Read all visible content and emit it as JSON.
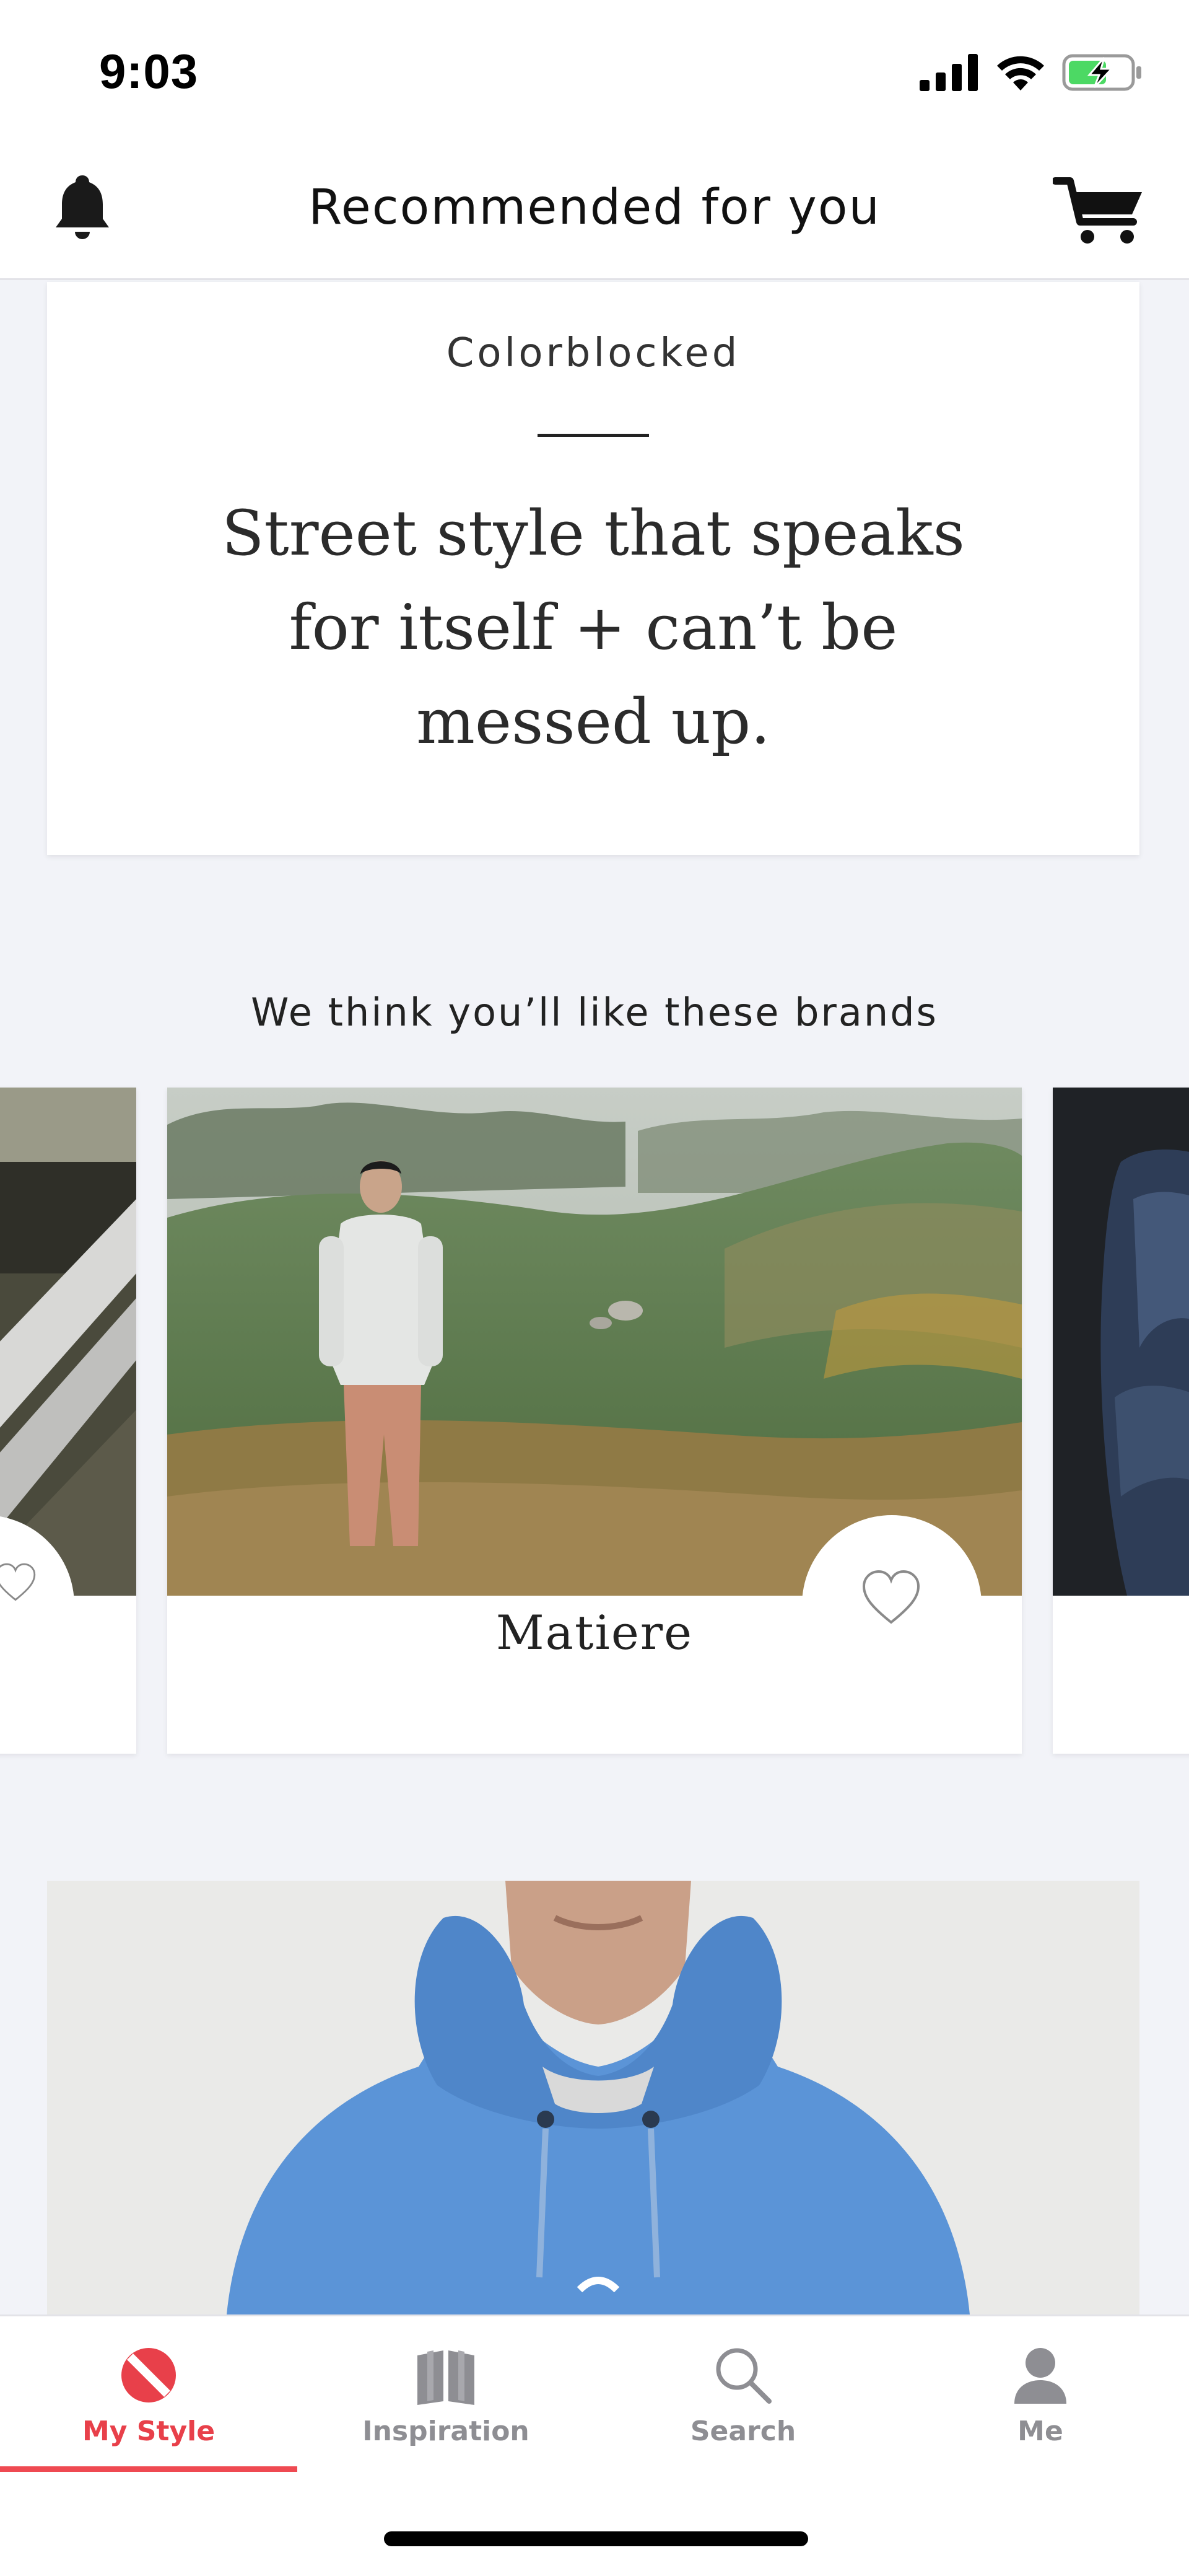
{
  "status_bar": {
    "time": "9:03"
  },
  "header": {
    "title": "Recommended for you"
  },
  "editorial": {
    "eyebrow": "Colorblocked",
    "headline": "Street style that speaks for itself + can’t be messed up."
  },
  "brands_section": {
    "heading": "We think you’ll like these brands",
    "brands": [
      {
        "name": ""
      },
      {
        "name": "Matiere"
      },
      {
        "name": ""
      }
    ]
  },
  "tab_bar": {
    "tabs": [
      {
        "label": "My Style",
        "icon": "my-style-icon",
        "active": true
      },
      {
        "label": "Inspiration",
        "icon": "book-icon",
        "active": false
      },
      {
        "label": "Search",
        "icon": "search-icon",
        "active": false
      },
      {
        "label": "Me",
        "icon": "person-icon",
        "active": false
      }
    ]
  },
  "colors": {
    "accent": "#E8404A",
    "inactive_tab": "#8E8E93",
    "background": "#F2F3F8"
  }
}
